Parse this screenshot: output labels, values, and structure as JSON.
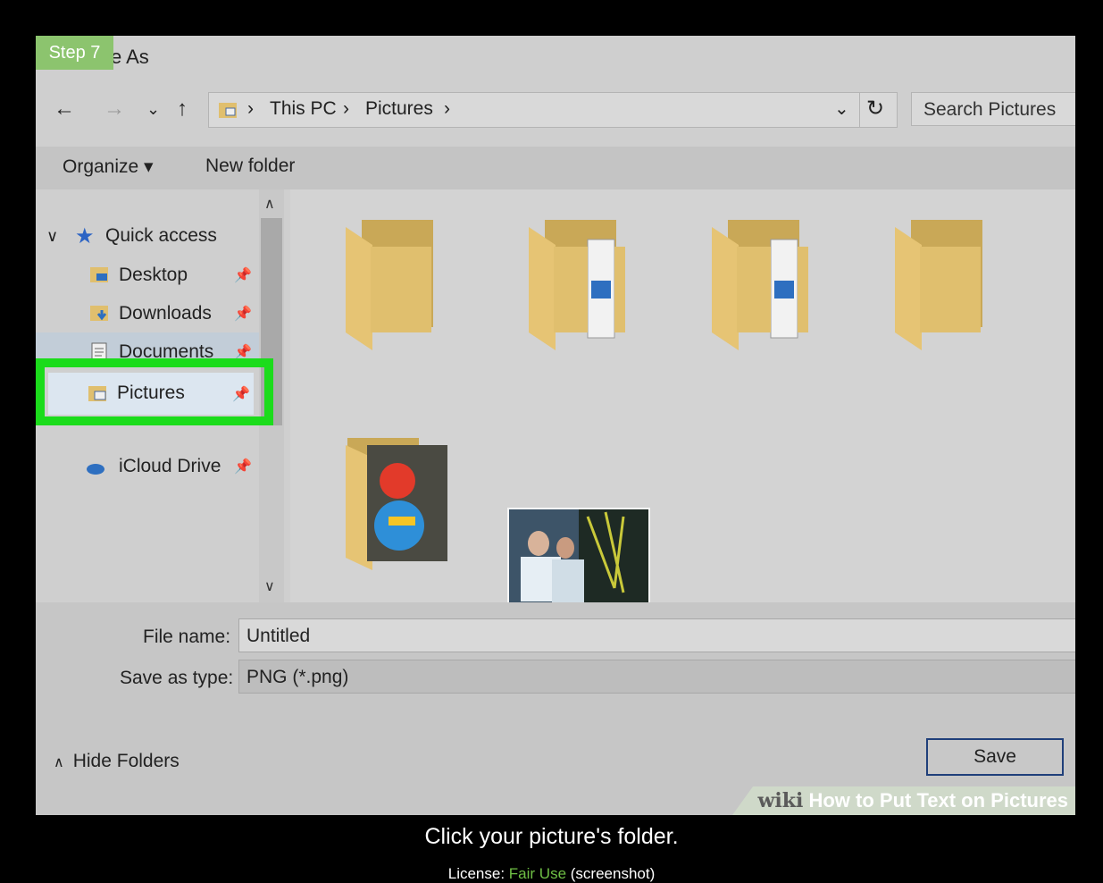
{
  "step_badge": "Step 7",
  "window_title": "e As",
  "nav": {
    "back": "←",
    "forward": "→",
    "recent": "⌄",
    "up": "↑"
  },
  "address": {
    "crumbs": [
      "This PC",
      "Pictures"
    ],
    "separator": "›"
  },
  "search": {
    "placeholder": "Search Pictures"
  },
  "toolbar": {
    "organize": "Organize ▾",
    "new_folder": "New folder"
  },
  "sidebar": {
    "quick_access": "Quick access",
    "items": [
      {
        "label": "Desktop",
        "pinned": true
      },
      {
        "label": "Downloads",
        "pinned": true
      },
      {
        "label": "Documents",
        "pinned": true
      },
      {
        "label": "Pictures",
        "pinned": true,
        "selected": true
      },
      {
        "label": "iCloud Drive",
        "pinned": true
      }
    ]
  },
  "files": {
    "file_name_label": "File name:",
    "file_name_value": "Untitled",
    "save_as_type_label": "Save as type:",
    "save_as_type_value": "PNG (*.png)"
  },
  "actions": {
    "hide_folders": "Hide Folders",
    "save": "Save"
  },
  "watermark": {
    "brand": "wiki",
    "title": "How to Put Text on Pictures"
  },
  "caption": "Click your picture's folder.",
  "license": {
    "prefix": "License:",
    "type": "Fair Use",
    "suffix": "(screenshot)"
  },
  "colors": {
    "highlight": "#1bdc1b",
    "step_badge": "#8cc46e",
    "folder": "#e0bf6e"
  }
}
